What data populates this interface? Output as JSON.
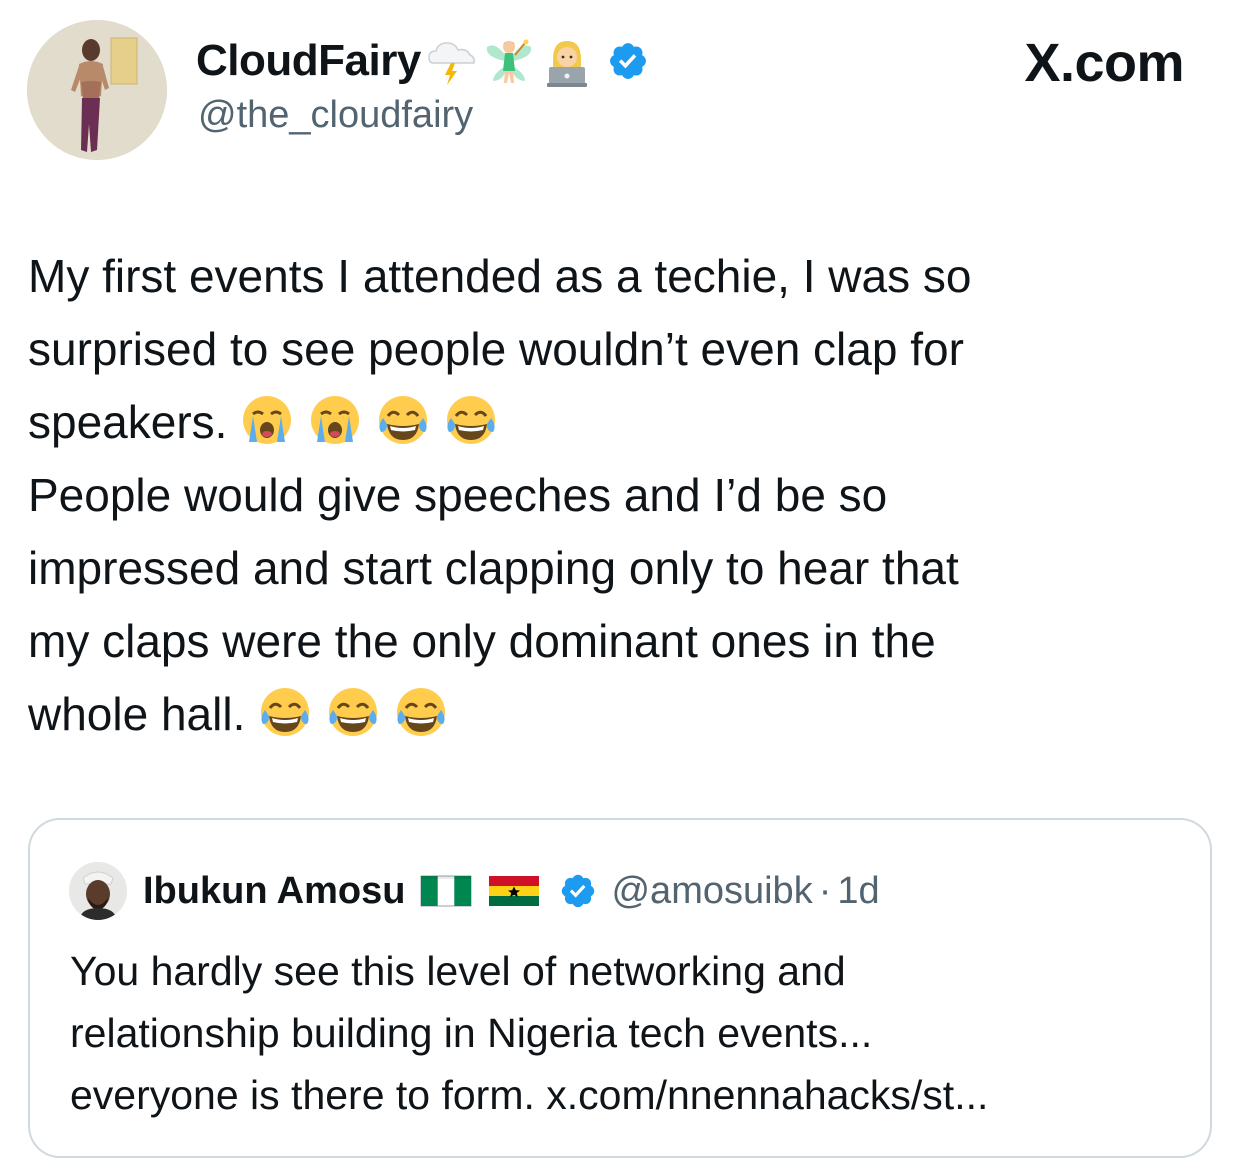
{
  "header": {
    "display_name": "CloudFairy",
    "name_emojis": [
      "cloud-lightning-icon",
      "fairy-icon",
      "technologist-icon"
    ],
    "handle": "@the_cloudfairy",
    "brand": "X.com",
    "verified_color": "#1d9bf0"
  },
  "tweet": {
    "lines": [
      "My first events I attended as a techie, I was so",
      "surprised to see people wouldn’t even clap for",
      "speakers.",
      "People would give speeches and I’d be so",
      "impressed and start clapping only to hear that",
      "my claps were the only dominant ones in the",
      "whole hall."
    ],
    "line3_emojis": [
      "crying-face-icon",
      "crying-face-icon",
      "tears-of-joy-icon",
      "tears-of-joy-icon"
    ],
    "line7_emojis": [
      "tears-of-joy-icon",
      "tears-of-joy-icon",
      "tears-of-joy-icon"
    ]
  },
  "quote": {
    "display_name": "Ibukun Amosu",
    "flags": [
      "nigeria-flag-icon",
      "ghana-flag-icon"
    ],
    "handle": "@amosuibk",
    "separator": "·",
    "time": "1d",
    "lines": [
      "You hardly see this level of networking and",
      "relationship building in Nigeria tech events...",
      "everyone is there to form. x.com/nnennahacks/st..."
    ]
  },
  "colors": {
    "text": "#0f1419",
    "secondary": "#536471",
    "border": "#cfd9de",
    "verified": "#1d9bf0"
  }
}
